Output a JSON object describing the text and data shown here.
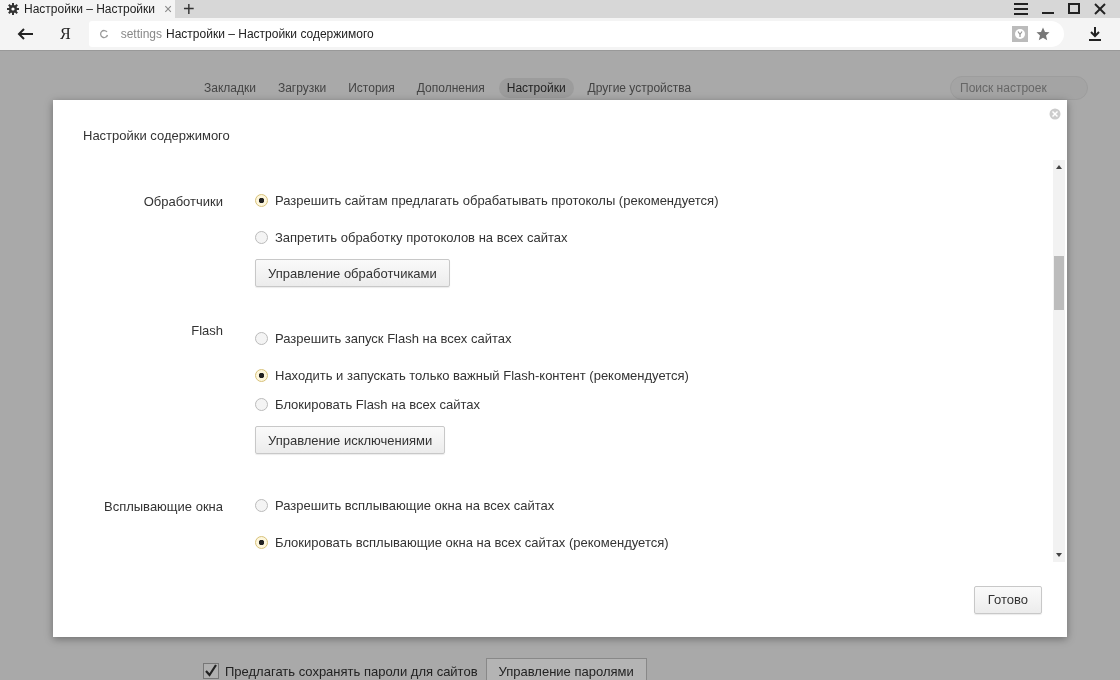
{
  "browser": {
    "tab": {
      "title": "Настройки – Настройки",
      "close": "×"
    },
    "new_tab": "+",
    "logo": "Я",
    "address": {
      "prefix": "settings",
      "text": "Настройки – Настройки содержимого"
    }
  },
  "nav": {
    "items": [
      {
        "label": "Закладки",
        "selected": false
      },
      {
        "label": "Загрузки",
        "selected": false
      },
      {
        "label": "История",
        "selected": false
      },
      {
        "label": "Дополнения",
        "selected": false
      },
      {
        "label": "Настройки",
        "selected": true
      },
      {
        "label": "Другие устройства",
        "selected": false
      }
    ],
    "search": {
      "placeholder": "Поиск настроек"
    }
  },
  "dialog": {
    "title": "Настройки содержимого",
    "sections": [
      {
        "label": "Обработчики",
        "options": [
          {
            "label": "Разрешить сайтам предлагать обрабатывать протоколы (рекомендуется)",
            "selected": true
          },
          {
            "label": "Запретить обработку протоколов на всех сайтах",
            "selected": false
          }
        ],
        "button": "Управление обработчиками"
      },
      {
        "label": "Flash",
        "options": [
          {
            "label": "Разрешить запуск Flash на всех сайтах",
            "selected": false
          },
          {
            "label": "Находить и запускать только важный Flash-контент (рекомендуется)",
            "selected": true
          },
          {
            "label": "Блокировать Flash на всех сайтах",
            "selected": false
          }
        ],
        "button": "Управление исключениями"
      },
      {
        "label": "Всплывающие окна",
        "options": [
          {
            "label": "Разрешить всплывающие окна на всех сайтах",
            "selected": false
          },
          {
            "label": "Блокировать всплывающие окна на всех сайтах (рекомендуется)",
            "selected": true
          }
        ]
      }
    ],
    "done": "Готово"
  },
  "background_rows": [
    {
      "label": "Предлагать сохранять пароли для сайтов",
      "checked": true,
      "button": "Управление паролями"
    }
  ]
}
